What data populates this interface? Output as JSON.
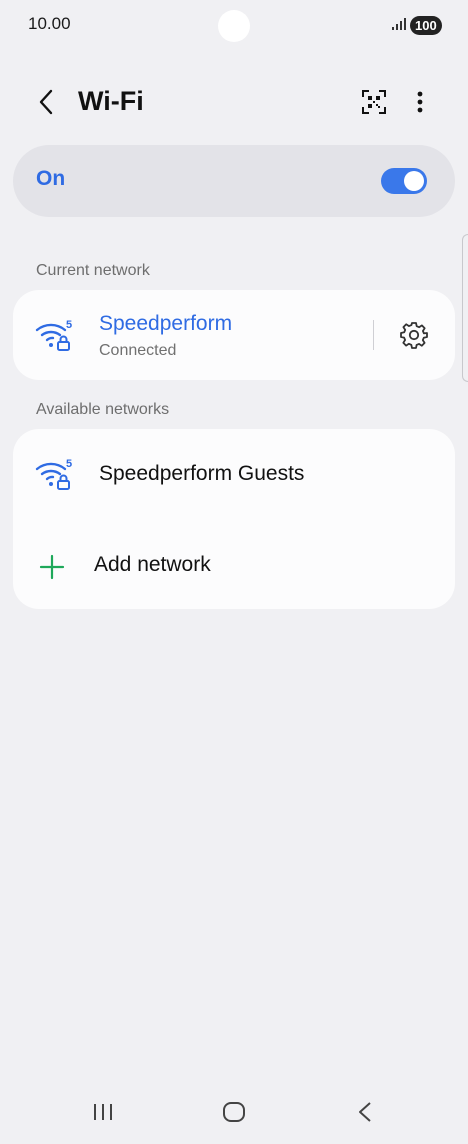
{
  "status_bar": {
    "time": "10.00",
    "battery": "100"
  },
  "header": {
    "title": "Wi-Fi"
  },
  "toggle": {
    "label": "On",
    "state": "on",
    "accent": "#3a78ea"
  },
  "current_network": {
    "section_title": "Current network",
    "name": "Speedperform",
    "status": "Connected",
    "band_badge": "5"
  },
  "available_networks": {
    "section_title": "Available networks",
    "items": [
      {
        "name": "Speedperform Guests",
        "band_badge": "5"
      }
    ],
    "add_label": "Add network"
  },
  "icons": {
    "back": "chevron-left-icon",
    "qr": "qr-scan-icon",
    "more": "more-vertical-icon",
    "wifi": "wifi-lock-icon",
    "gear": "gear-icon",
    "add": "plus-icon"
  },
  "colors": {
    "accent_blue": "#2f6be3",
    "plus_green": "#1ea85a"
  }
}
